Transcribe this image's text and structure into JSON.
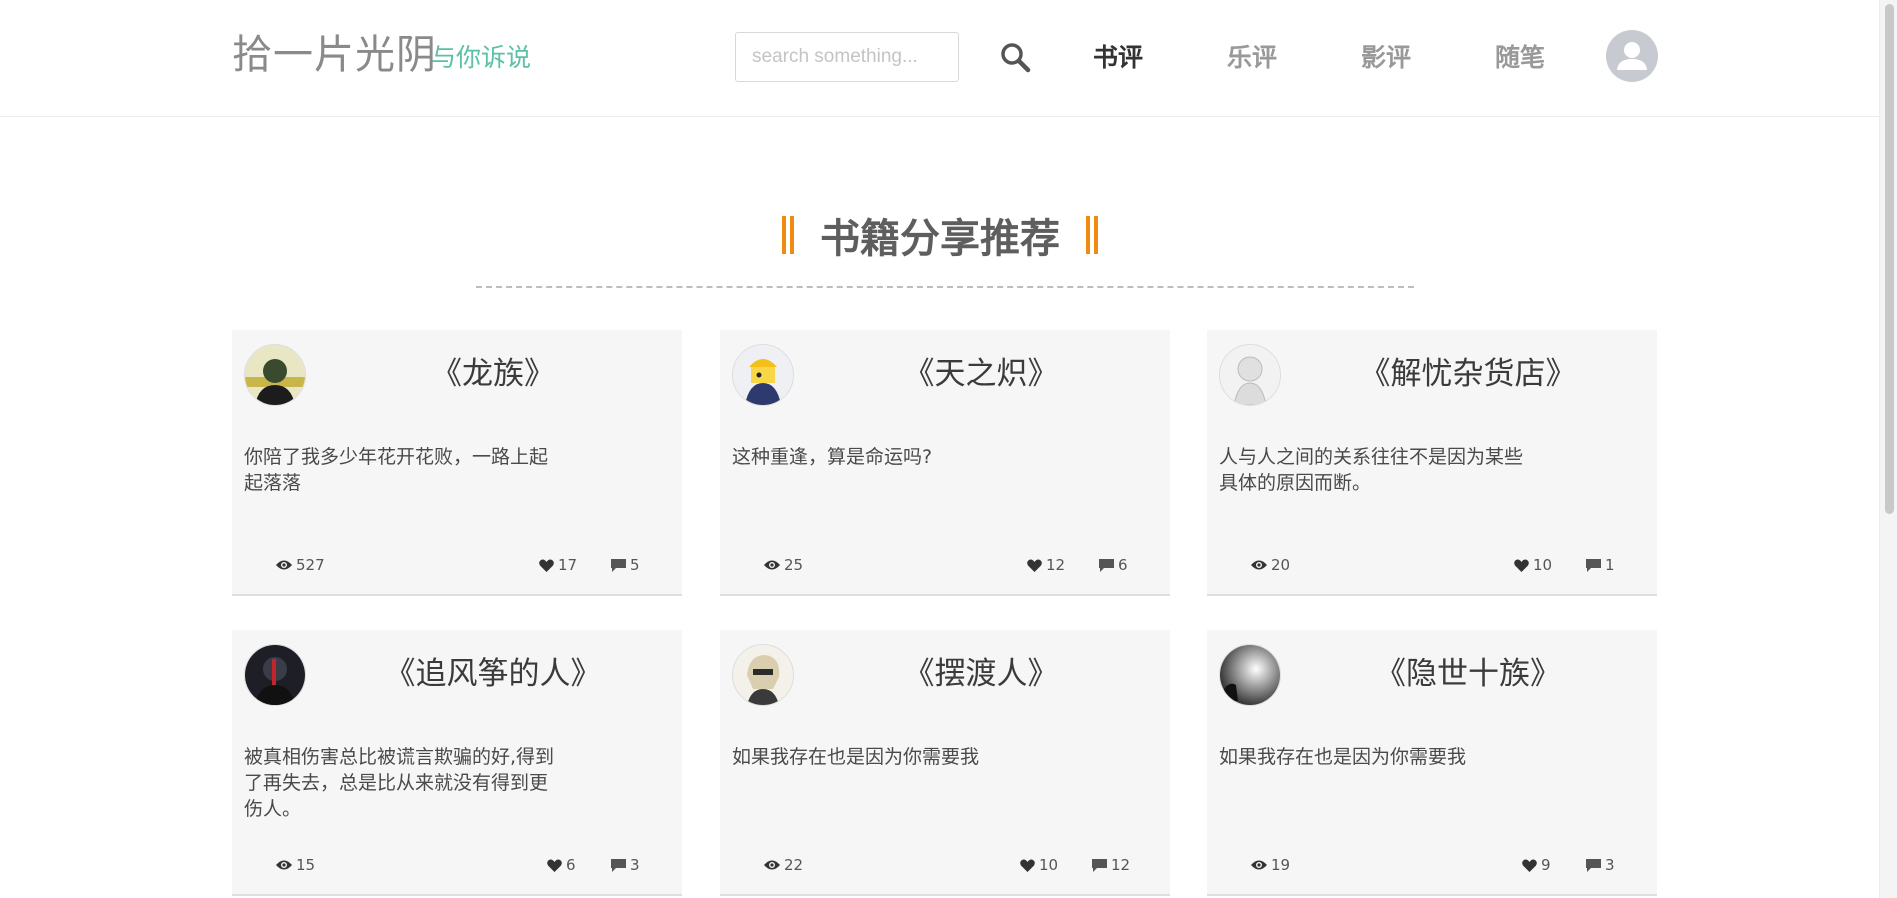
{
  "brand": {
    "title": "拾一片光阴",
    "subtitle": "与你诉说"
  },
  "search": {
    "placeholder": "search something..."
  },
  "nav": [
    {
      "label": "书评",
      "active": true
    },
    {
      "label": "乐评",
      "active": false
    },
    {
      "label": "影评",
      "active": false
    },
    {
      "label": "随笔",
      "active": false
    }
  ],
  "section": {
    "title": "书籍分享推荐"
  },
  "colors": {
    "accent": "#f08a10",
    "brand_sub": "#5cc0a6"
  },
  "cards": [
    {
      "title": "《龙族》",
      "desc": "你陪了我多少年花开花败，一路上起起落落",
      "views": "527",
      "likes": "17",
      "comments": "5"
    },
    {
      "title": "《天之炽》",
      "desc": "这种重逢，算是命运吗?",
      "views": "25",
      "likes": "12",
      "comments": "6"
    },
    {
      "title": "《解忧杂货店》",
      "desc": "人与人之间的关系往往不是因为某些具体的原因而断。",
      "views": "20",
      "likes": "10",
      "comments": "1"
    },
    {
      "title": "《追风筝的人》",
      "desc": "被真相伤害总比被谎言欺骗的好,得到了再失去，总是比从来就没有得到更伤人。",
      "views": "15",
      "likes": "6",
      "comments": "3"
    },
    {
      "title": "《摆渡人》",
      "desc": "如果我存在也是因为你需要我",
      "views": "22",
      "likes": "10",
      "comments": "12"
    },
    {
      "title": "《隐世十族》",
      "desc": "如果我存在也是因为你需要我",
      "views": "19",
      "likes": "9",
      "comments": "3"
    }
  ],
  "icons": {
    "views": "eye-icon",
    "likes": "heart-icon",
    "comments": "comment-icon",
    "search": "search-icon",
    "user": "user-icon"
  }
}
